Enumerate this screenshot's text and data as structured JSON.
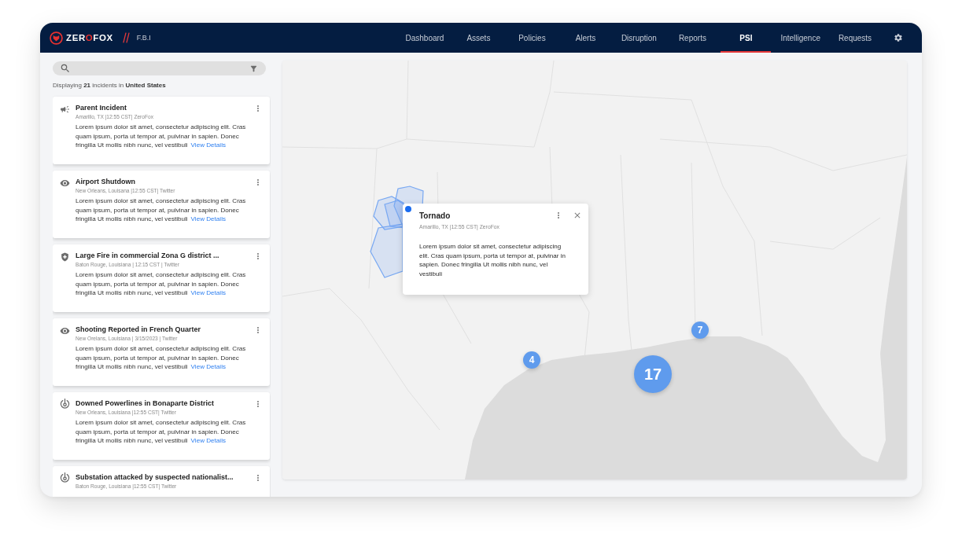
{
  "header": {
    "logo_text": "ZEROFOX",
    "organization": "F.B.I",
    "nav": [
      {
        "label": "Dashboard",
        "selected": false
      },
      {
        "label": "Assets",
        "selected": false
      },
      {
        "label": "Policies",
        "selected": false
      },
      {
        "label": "Alerts",
        "selected": false
      },
      {
        "label": "Disruption",
        "selected": false
      },
      {
        "label": "Reports",
        "selected": false
      },
      {
        "label": "PSI",
        "selected": true
      },
      {
        "label": "Intelligence",
        "selected": false
      },
      {
        "label": "Requests",
        "selected": false
      }
    ]
  },
  "sidebar": {
    "summary": "Displaying **21** incidents in **United States**",
    "incidents": [
      {
        "kind": "announcement",
        "title": "Parent Incident",
        "meta": "Amarillo, TX |12:55 CST| ZeroFox",
        "body": "Lorem ipsum dolor sit amet, consectetur adipiscing elit. Cras quam ipsum, porta ut tempor at, pulvinar in sapien. Donec fringilla Ut mollis nibh nunc, vel vestibuli",
        "link": "View Details"
      },
      {
        "kind": "watch",
        "title": "Airport Shutdown",
        "meta": "New Orleans, Louisana |12:55 CST| Twitter",
        "body": "Lorem ipsum dolor sit amet, consectetur adipiscing elit. Cras quam ipsum, porta ut tempor at, pulvinar in sapien. Donec fringilla Ut mollis nibh nunc, vel vestibuli",
        "link": "View Details"
      },
      {
        "kind": "shield",
        "title": "Large Fire in commercial Zona G district ...",
        "meta": "Baton Rouge, Louisiana | 12:15 CST | Twitter",
        "body": "Lorem ipsum dolor sit amet, consectetur adipiscing elit. Cras quam ipsum, porta ut tempor at, pulvinar in sapien. Donec fringilla Ut mollis nibh nunc, vel vestibuli",
        "link": "View Details"
      },
      {
        "kind": "watch",
        "title": "Shooting Reported in French Quarter",
        "meta": "New Orelans, Louisiana | 3/15/2023 | Twitter",
        "body": "Lorem ipsum dolor sit amet, consectetur adipiscing elit. Cras quam ipsum, porta ut tempor at, pulvinar in sapien. Donec fringilla Ut mollis nibh nunc, vel vestibuli",
        "link": "View Details"
      },
      {
        "kind": "power",
        "title": "Downed Powerlines in Bonaparte District",
        "meta": "New Orleans, Louisiana |12:55 CST| Twitter",
        "body": "Lorem ipsum dolor sit amet, consectetur adipiscing elit. Cras quam ipsum, porta ut tempor at, pulvinar in sapien. Donec fringilla Ut mollis nibh nunc, vel vestibuli",
        "link": "View Details"
      },
      {
        "kind": "power",
        "title": "Substation attacked by suspected nationalist...",
        "meta": "Baton Rouge, Louisiana |12:55 CST| Twitter"
      }
    ]
  },
  "map": {
    "popup": {
      "title": "Tornado",
      "meta": "Amarillo, TX |12:55 CST| ZeroFox",
      "body": "Lorem ipsum dolor sit amet, consectetur adipiscing elit. Cras quam ipsum, porta ut tempor at, pulvinar in sapien. Donec fringilla Ut mollis nibh nunc, vel vestibuli"
    },
    "clusters": [
      {
        "count": "4"
      },
      {
        "count": "17"
      },
      {
        "count": "7"
      }
    ]
  }
}
